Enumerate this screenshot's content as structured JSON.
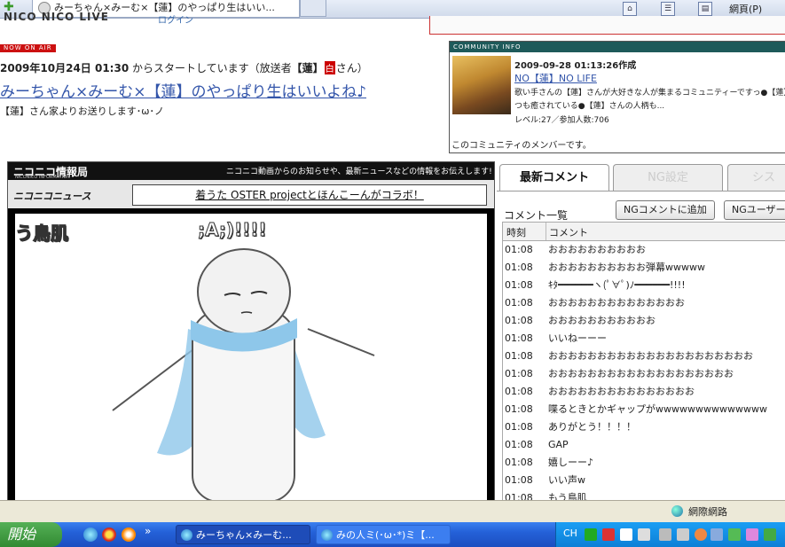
{
  "browser": {
    "tab_title": "みーちゃん×みーむ×【蓮】のやっぱり生はいい...",
    "news_label": "網頁(P)"
  },
  "page": {
    "logo_text": "NICO NICO LIVE",
    "login_text": "ログイン",
    "onair_label": "NOW ON AIR",
    "start_date": "2009年10月24日 01:30",
    "start_suffix": "からスタートしています（放送者",
    "owner_name": "【蓮】",
    "owner_badge": "白",
    "owner_suffix": "さん）",
    "title": "みーちゃん×みーむ×【蓮】のやっぱり生はいいよね♪",
    "from_line": "【蓮】さん家よりお送りします･ω･ノ"
  },
  "community": {
    "header": "COMMUNITY INFO",
    "date": "2009-09-28 01:13:26作成",
    "name": "NO【蓮】NO LIFE",
    "desc_1": "歌い手さんの【蓮】さんが大好きな人が集まるコミュニティーですっ●【蓮】",
    "desc_2": "つも癒されている●【蓮】さんの人柄も...",
    "level": "レベル:27／参加人数:706",
    "member_note": "このコミュニティのメンバーです。"
  },
  "player": {
    "info_logo": "ニコニコ情報局",
    "info_logo_sub": "NICONICO INFORMATION",
    "info_msg": "ニコニコ動画からのお知らせや、最新ニュースなどの情報をお伝えします!",
    "news_logo": "ニコニコニュース",
    "news_banner": "着うた OSTER projectとほんこーんがコラボ！",
    "overlay_1": "う鳥肌",
    "overlay_2": ";A;)!!!!"
  },
  "comments": {
    "tab_latest": "最新コメント",
    "tab_ng": "NG設定",
    "tab_sys": "シス",
    "list_label": "コメント一覧",
    "btn_ng_add": "NGコメントに追加",
    "btn_ng_user": "NGユーザー",
    "col_time": "時刻",
    "col_comment": "コメント",
    "rows": [
      {
        "time": "01:08",
        "text": "おおおおおおおおおお"
      },
      {
        "time": "01:08",
        "text": "おおおおおおおおおお弾幕wwwww"
      },
      {
        "time": "01:08",
        "text": "ｷﾀ━━━━━━ヽ(ﾟ∀ﾟ)ﾉ━━━━━━!!!!"
      },
      {
        "time": "01:08",
        "text": "おおおおおおおおおおおおおお"
      },
      {
        "time": "01:08",
        "text": "おおおおおおおおおおお"
      },
      {
        "time": "01:08",
        "text": "いいねーーー"
      },
      {
        "time": "01:08",
        "text": "おおおおおおおおおおおおおおおおおおおおお"
      },
      {
        "time": "01:08",
        "text": "おおおおおおおおおおおおおおおおおおお"
      },
      {
        "time": "01:08",
        "text": "おおおおおおおおおおおおおおお"
      },
      {
        "time": "01:08",
        "text": "喋るときとかギャップがwwwwwwwwwwwwww"
      },
      {
        "time": "01:08",
        "text": "ありがとう！！！！"
      },
      {
        "time": "01:08",
        "text": "GAP"
      },
      {
        "time": "01:08",
        "text": "嬉しーー♪"
      },
      {
        "time": "01:08",
        "text": "いい声w"
      },
      {
        "time": "01:08",
        "text": "もう鳥肌"
      }
    ]
  },
  "statusbar": {
    "zone": "網際網路"
  },
  "taskbar": {
    "start": "開始",
    "more": "»",
    "task_1": "みーちゃん×みーむ...",
    "task_2": "みの人ミ(･ω･*)ミ【...",
    "tray_ch": "CH"
  }
}
